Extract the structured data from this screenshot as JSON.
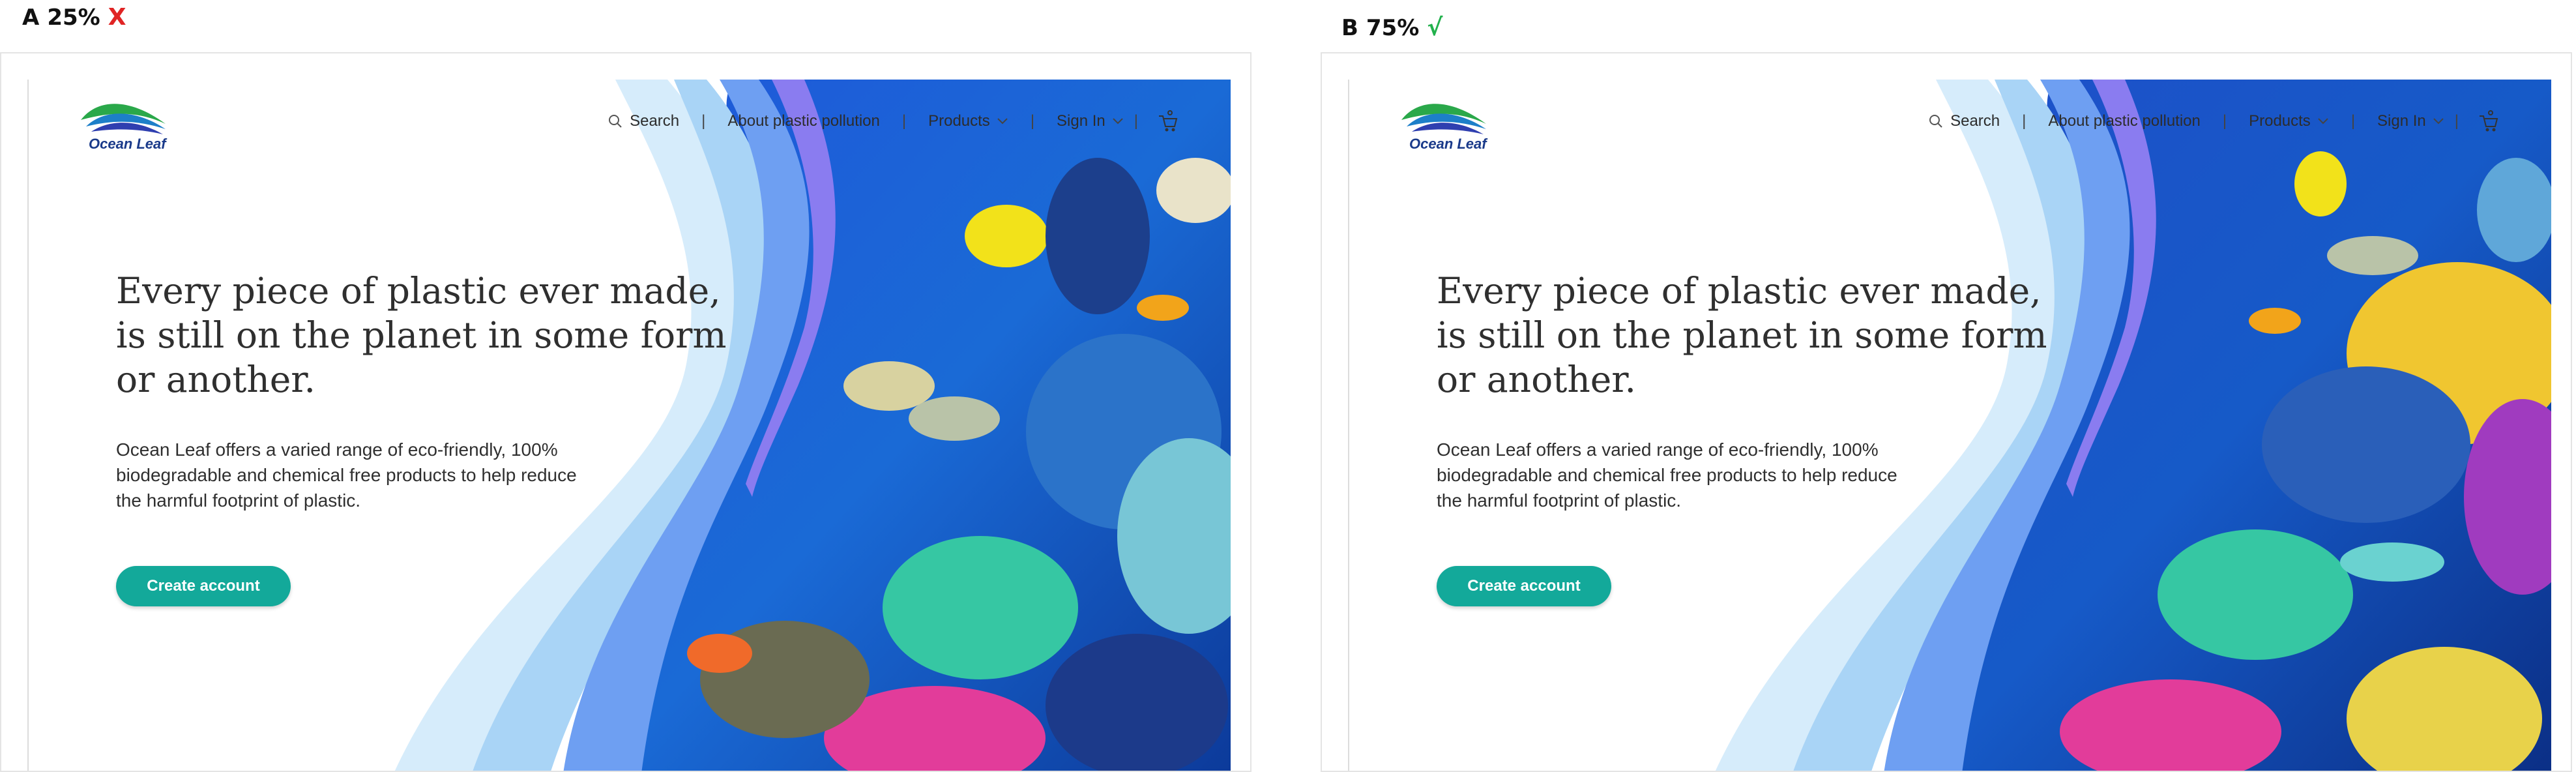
{
  "variants": [
    {
      "letter": "A",
      "percent": "25%",
      "mark": "X",
      "mark_color": "#e02424"
    },
    {
      "letter": "B",
      "percent": "75%",
      "mark": "√",
      "mark_color": "#22b14c"
    }
  ],
  "page": {
    "brand": "Ocean Leaf",
    "nav": {
      "search": "Search",
      "about": "About plastic pollution",
      "products": "Products",
      "sign_in": "Sign In",
      "separator": "|"
    },
    "headline": "Every piece of plastic ever made, is still on the planet in some form or another.",
    "subtext": "Ocean Leaf offers a varied range of eco-friendly, 100% biodegradable and chemical free products to help reduce the harmful footprint of plastic.",
    "cta": "Create account"
  },
  "colors": {
    "teal": "#13a99a",
    "brand_blue": "#1a3a8a",
    "wave_light": "#bfe0f7",
    "wave_mid": "#8fc6f2",
    "wave_dark": "#5b8ef0",
    "wave_purple": "#8a7cf0"
  }
}
